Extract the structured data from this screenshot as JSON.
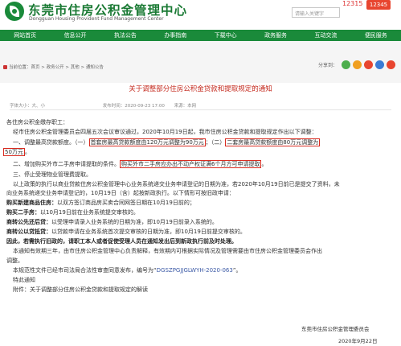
{
  "header": {
    "title": "东莞市住房公积金管理中心",
    "subtitle": "Dongguan Housing Provident Fund Management Center",
    "search_placeholder": "请输入关键字",
    "search_number": "12315",
    "search_button": "12345"
  },
  "nav": [
    "网站首页",
    "信息公开",
    "执法公告",
    "办事指南",
    "下载中心",
    "政务服务",
    "互动交流",
    "便民服务"
  ],
  "breadcrumb": "当前位置：首页 > 政务公开 > 其他 > 通知公告",
  "share_label": "分享到：",
  "share_colors": [
    "#4cae4c",
    "#f0a020",
    "#e8452f",
    "#3a7bd5",
    "#e8452f"
  ],
  "article": {
    "title": "关于调整部分住房公积金贷款和提取规定的通知",
    "meta_font": "字体大小：大、小",
    "meta_date": "发布时间：2020-09-23 17:00",
    "meta_source": "来源：本网"
  },
  "body": {
    "greeting": "各住房公积金缴存职工：",
    "p1": "经市住房公积金管理委员会四届五次会议审议通过，2020年10月19日起，我市住房公积金贷款和提取规定作出以下调整：",
    "p2_prefix": "一、调整最高贷款额度。（一）",
    "p2_box1": "首套房最高贷款额度由120万元调整为90万元",
    "p2_mid": "；（二）",
    "p2_box2": "二套房最高贷款额度由80万元调整为",
    "p3_box": "50万元",
    "p3_suffix": "。",
    "p4_prefix": "二、增加购买外市二手房申请提取的条件。",
    "p4_box": "购买外市二手房应办出不动产权证满6个月方可申请提取",
    "p4_suffix": "。",
    "p5": "三、停止受理物业管理费提取。",
    "p6": "以上政策的执行以商业贷款住房公积金管理中心业务系统递交业务申请登记的日期为准，若2020年10月19日前已是提交了资料，未",
    "p7": "向业务系统递交业务申请登记的，10月19日（含）起按新政执行。以下情形可按旧政申请：",
    "p8_bold": "购买新建商品住房：",
    "p8": "以双方签订商品房买卖合同网签日期在10月19日前的；",
    "p9_bold": "购买二手房：",
    "p9": "以10月19日前在业务系统提交审核的。",
    "p10_bold": "商转公先还后贷：",
    "p10": "以受理申请录入业务系统的日期为准，即10月19日前录入系统的。",
    "p11_bold": "商转公以贷抵贷：",
    "p11": "以贷款申请在业务系统首次提交审核的日期为准，即10月19日前提交审核的。",
    "p12": "因此，若需执行旧政的，请职工本人或者促使受理人员在通知发出后到新政执行前及时处理。",
    "p13": "本通知有效期三年，由市住房公积金管理中心负责解释，有效期内可根据实际情况及管理需要由市住房公积金管理委员会作出",
    "p14": "调整。",
    "p15_prefix": "本规范性文件已经市司法局合法性审查同意发布，编号为“",
    "p15_code": "DGSZPGJJGLWYH-2020-063",
    "p15_suffix": "”。",
    "p16": "特此通知",
    "p17": "附件：关于调整部分住房公积金贷款和提取规定的解读",
    "sign_org": "东莞市住房公积金管理委员会",
    "sign_date": "2020年9月22日"
  }
}
